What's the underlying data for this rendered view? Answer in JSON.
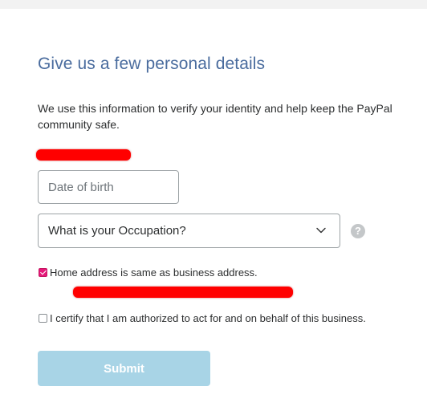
{
  "form": {
    "title": "Give us a few personal details",
    "intro": "We use this information to verify your identity and help keep the PayPal community safe.",
    "dob_placeholder": "Date of birth",
    "dob_value": "",
    "occupation_selected": "What is your Occupation?",
    "help_label": "?",
    "home_address_label": "Home address is same as business address.",
    "home_address_checked": true,
    "certify_label": "I certify that I am authorized to act for and on behalf of this business.",
    "certify_checked": false,
    "submit_label": "Submit"
  },
  "icons": {
    "dropdown": "chevron-down-icon",
    "help": "question-mark-icon",
    "checkmark": "checkmark-icon"
  },
  "colors": {
    "title": "#4a6c9e",
    "checkbox_checked": "#e5197a",
    "submit_disabled": "#a8d4e6",
    "redaction": "#ff0000",
    "help_icon": "#c4c7c9"
  }
}
